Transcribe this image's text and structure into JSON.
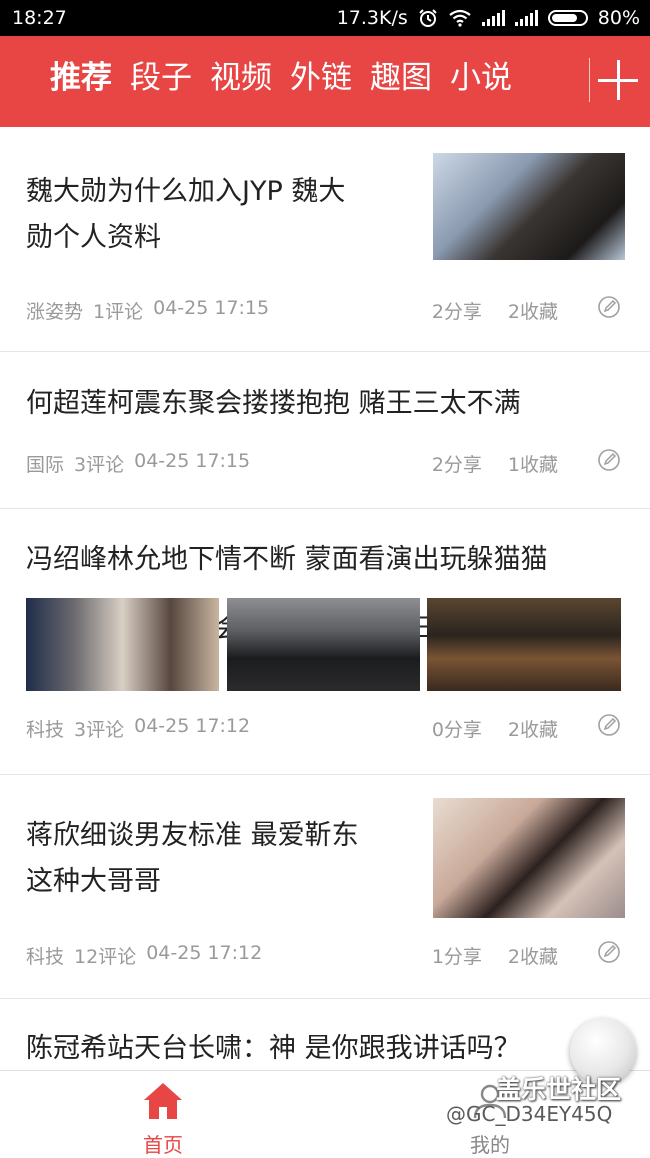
{
  "status_bar": {
    "time": "18:27",
    "net_speed": "17.3K/s",
    "battery": "80%",
    "icons": [
      "alarm-icon",
      "wifi-icon",
      "signal-icon",
      "signal-icon",
      "battery-icon"
    ]
  },
  "tabs": [
    {
      "label": "推荐",
      "active": true
    },
    {
      "label": "段子"
    },
    {
      "label": "视频"
    },
    {
      "label": "外链"
    },
    {
      "label": "趣图"
    },
    {
      "label": "小说"
    }
  ],
  "accent_color": "#e84545",
  "articles": [
    {
      "title_line1": "魏大勋为什么加入JYP 魏大",
      "title_line2": "勋个人资料",
      "source": "涨姿势",
      "comments": "1评论",
      "time": "04-25 17:15",
      "shares": "2分享",
      "favorites": "2收藏"
    },
    {
      "title": "何超莲柯震东聚会搂搂抱抱 赌王三太不满",
      "source": "国际",
      "comments": "3评论",
      "time": "04-25 17:15",
      "shares": "2分享",
      "favorites": "1收藏"
    },
    {
      "title": "冯绍峰林允地下情不断 蒙面看演出玩躲猫猫",
      "source": "科技",
      "comments": "3评论",
      "time": "04-25 17:12",
      "shares": "0分享",
      "favorites": "2收藏"
    },
    {
      "title_line1": "蒋欣细谈男友标准 最爱靳东",
      "title_line2": "这种大哥哥",
      "source": "科技",
      "comments": "12评论",
      "time": "04-25 17:12",
      "shares": "1分享",
      "favorites": "2收藏"
    },
    {
      "title": "陈冠希站天台长啸：神 是你跟我讲话吗？"
    }
  ],
  "bottom_nav": {
    "home_label": "首页",
    "me_label": "我的"
  },
  "watermark": {
    "brand": "盖乐世社区",
    "user": "@GC_D34EY45Q"
  }
}
